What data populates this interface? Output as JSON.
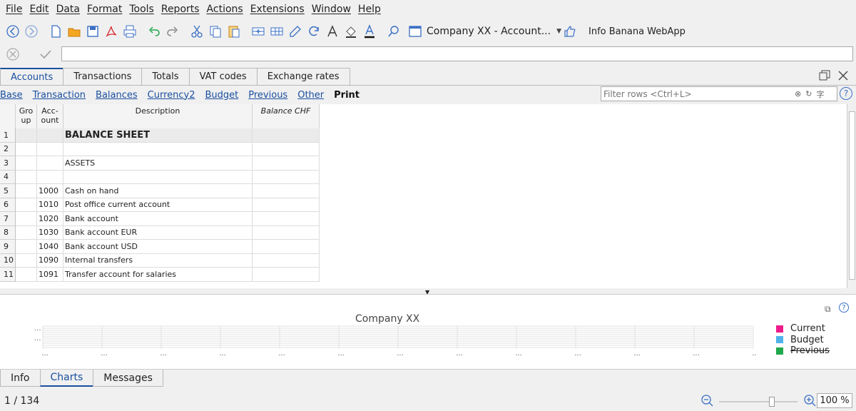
{
  "menu": [
    "File",
    "Edit",
    "Data",
    "Format",
    "Tools",
    "Reports",
    "Actions",
    "Extensions",
    "Window",
    "Help"
  ],
  "toolbar": {
    "company_select": "Company XX - Account...",
    "webapp_label": "Info Banana WebApp",
    "icons": [
      "back-icon",
      "forward-icon",
      "new-file-icon",
      "open-folder-icon",
      "save-icon",
      "pdf-icon",
      "print-icon",
      "undo-icon",
      "redo-icon",
      "cut-icon",
      "copy-icon",
      "paste-icon",
      "add-row-icon",
      "insert-row-icon",
      "edit-icon",
      "refresh-icon",
      "font-icon",
      "fill-color-icon",
      "font-color-icon",
      "search-icon",
      "file-icon",
      "like-icon"
    ]
  },
  "tabs": [
    "Accounts",
    "Transactions",
    "Totals",
    "VAT codes",
    "Exchange rates"
  ],
  "active_tab": "Accounts",
  "views": [
    "Base",
    "Transaction",
    "Balances",
    "Currency2",
    "Budget",
    "Previous",
    "Other",
    "Print"
  ],
  "active_view": "Print",
  "filter": {
    "placeholder": "Filter rows <Ctrl+L>"
  },
  "grid": {
    "headers": {
      "group": "Gro up",
      "account": "Acc- ount",
      "description": "Description",
      "balance": "Balance CHF"
    },
    "rows": [
      {
        "n": "1",
        "account": "",
        "description": "BALANCE SHEET",
        "style": "title"
      },
      {
        "n": "2",
        "account": "",
        "description": "",
        "style": ""
      },
      {
        "n": "3",
        "account": "",
        "description": "ASSETS",
        "style": "section"
      },
      {
        "n": "4",
        "account": "",
        "description": "",
        "style": ""
      },
      {
        "n": "5",
        "account": "1000",
        "description": "Cash on hand",
        "style": ""
      },
      {
        "n": "6",
        "account": "1010",
        "description": "Post office current account",
        "style": ""
      },
      {
        "n": "7",
        "account": "1020",
        "description": "Bank account",
        "style": ""
      },
      {
        "n": "8",
        "account": "1030",
        "description": "Bank account EUR",
        "style": ""
      },
      {
        "n": "9",
        "account": "1040",
        "description": "Bank account USD",
        "style": ""
      },
      {
        "n": "10",
        "account": "1090",
        "description": "Internal transfers",
        "style": ""
      },
      {
        "n": "11",
        "account": "1091",
        "description": "Transfer account for salaries",
        "style": ""
      }
    ]
  },
  "chart": {
    "title": "Company XX",
    "dots": "...",
    "legend": [
      {
        "name": "Current",
        "color": "#ee1c8a"
      },
      {
        "name": "Budget",
        "color": "#4fb2ea"
      },
      {
        "name": "Previous",
        "color": "#20a84a"
      }
    ]
  },
  "bottom_tabs": [
    "Info",
    "Charts",
    "Messages"
  ],
  "active_bottom_tab": "Charts",
  "status": {
    "position": "1 / 134",
    "zoom": "100 %"
  }
}
